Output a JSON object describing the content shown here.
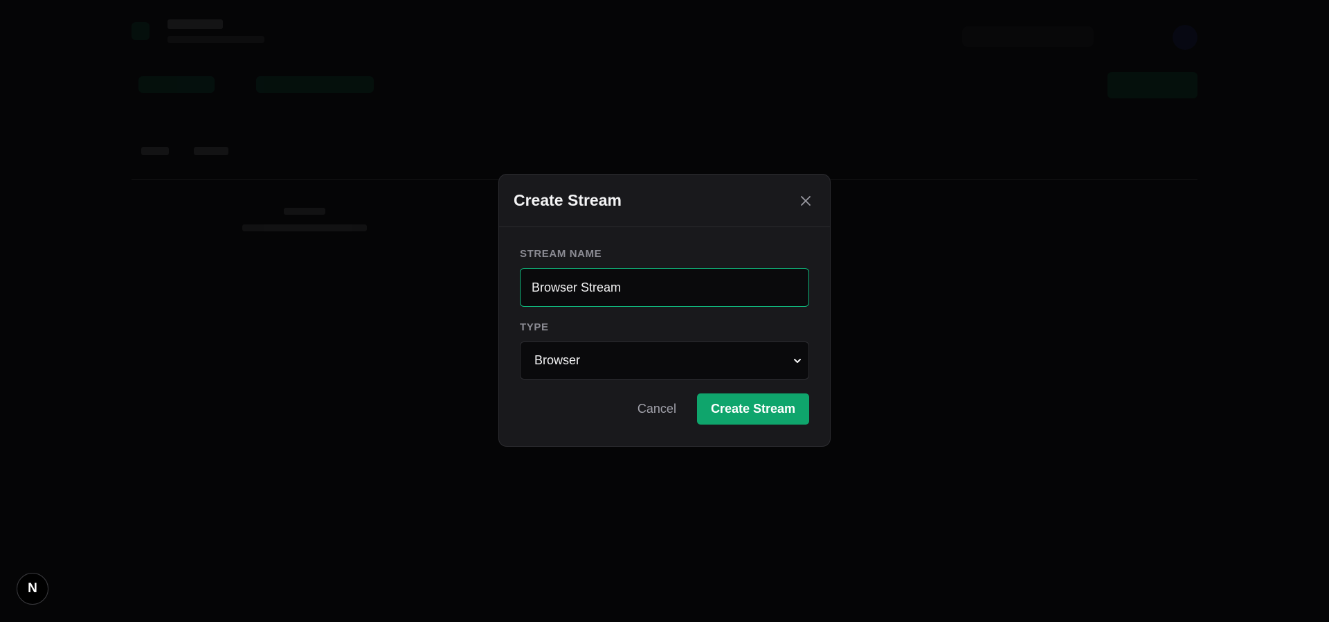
{
  "modal": {
    "title": "Create Stream",
    "close_icon": "close-icon",
    "fields": {
      "stream_name": {
        "label": "STREAM NAME",
        "value": "Browser Stream"
      },
      "type": {
        "label": "TYPE",
        "selected": "Browser",
        "chevron_icon": "chevron-down-icon"
      }
    },
    "actions": {
      "cancel_label": "Cancel",
      "submit_label": "Create Stream"
    }
  },
  "dev_indicator": {
    "letter": "N"
  },
  "colors": {
    "accent": "#0fa56c",
    "input_focus_border": "#10b47a",
    "modal_bg": "#19191c",
    "backdrop": "#000000"
  }
}
